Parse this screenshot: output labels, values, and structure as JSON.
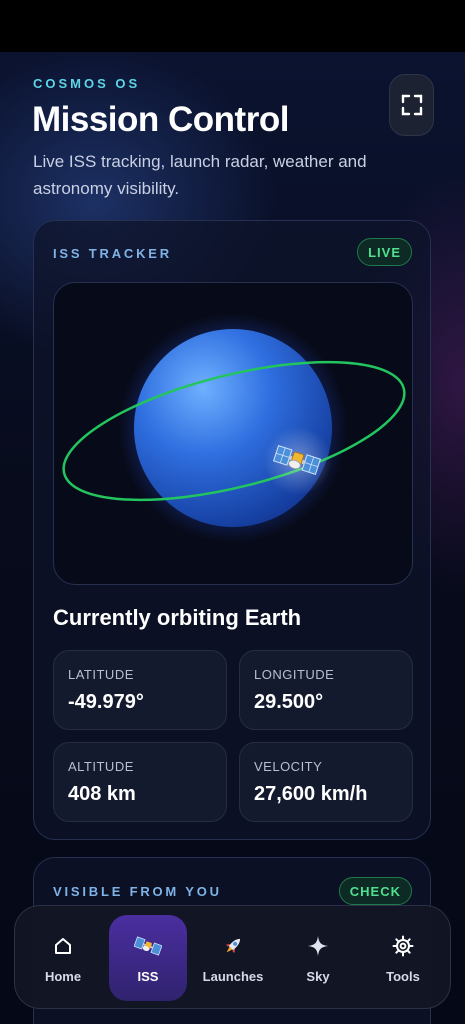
{
  "header": {
    "kicker": "COSMOS OS",
    "title": "Mission Control",
    "subtitle": "Live ISS tracking, launch radar, weather and astronomy visibility."
  },
  "fullscreen_icon": "fullscreen-icon",
  "iss_card": {
    "kicker": "ISS TRACKER",
    "badge": "LIVE",
    "heading": "Currently orbiting Earth",
    "stats": [
      {
        "label": "LATITUDE",
        "value": "-49.979°"
      },
      {
        "label": "LONGITUDE",
        "value": "29.500°"
      },
      {
        "label": "ALTITUDE",
        "value": "408 km"
      },
      {
        "label": "VELOCITY",
        "value": "27,600 km/h"
      }
    ]
  },
  "visible_card": {
    "kicker": "VISIBLE FROM YOU",
    "badge": "CHECK"
  },
  "tabbar": {
    "active": "ISS",
    "tabs": [
      {
        "label": "Home",
        "icon": "home-icon"
      },
      {
        "label": "ISS",
        "icon": "satellite-icon"
      },
      {
        "label": "Launches",
        "icon": "rocket-icon"
      },
      {
        "label": "Sky",
        "icon": "sparkle-icon"
      },
      {
        "label": "Tools",
        "icon": "gear-icon"
      }
    ]
  },
  "colors": {
    "accent_cyan": "#5fd4e6",
    "live_green": "#4fe08f",
    "orbit_green": "#22c55e",
    "active_tab": "#4a2ea0"
  }
}
